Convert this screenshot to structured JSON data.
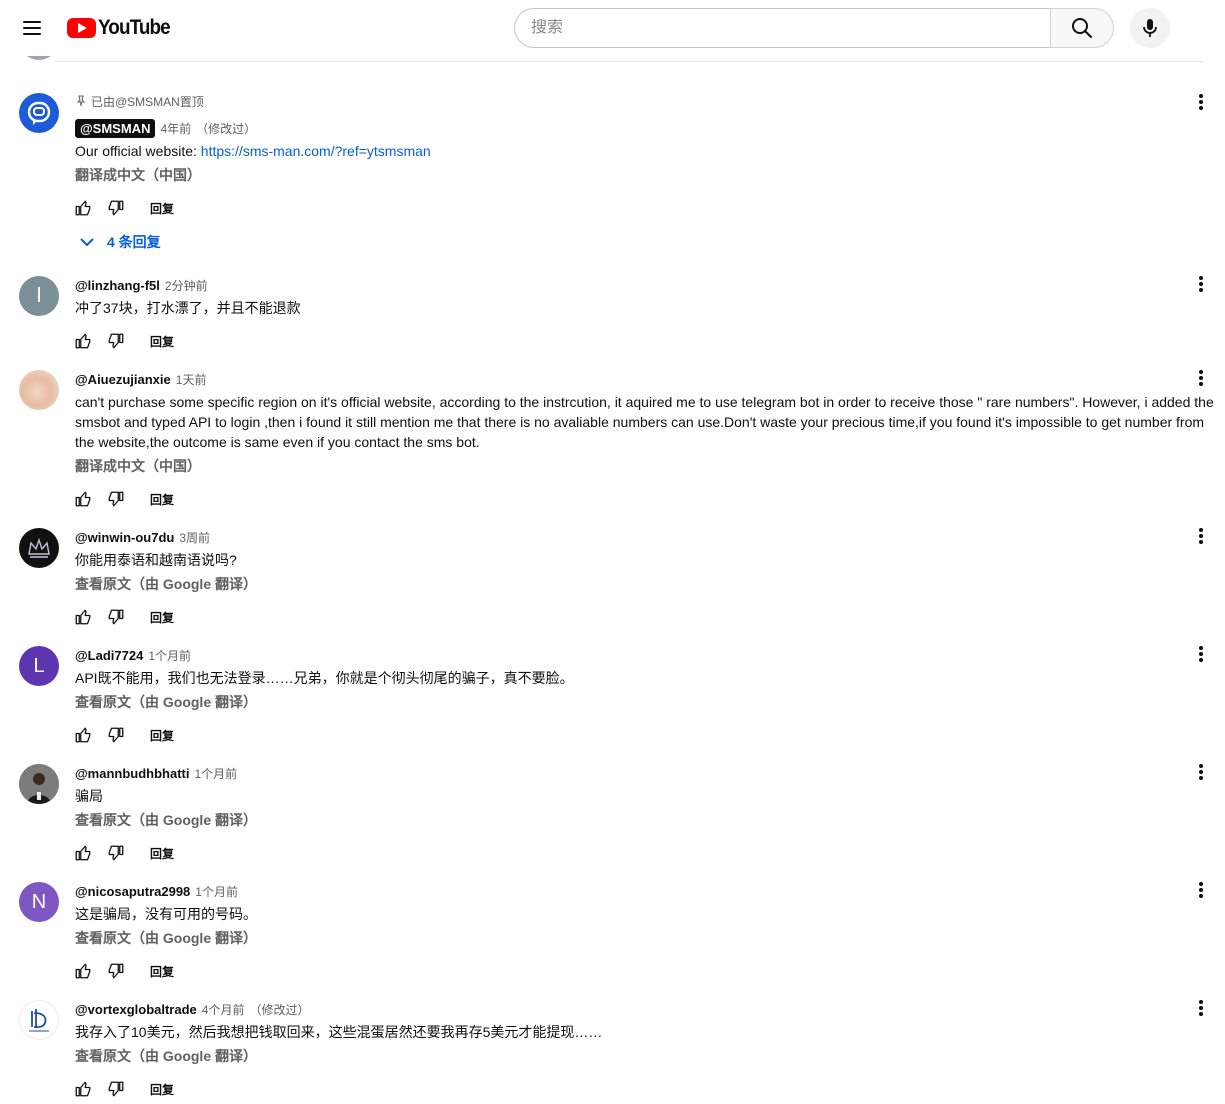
{
  "header": {
    "logo_text": "YouTube",
    "search_placeholder": "搜索"
  },
  "comments": [
    {
      "pinned_label": "已由@SMSMAN置顶",
      "author": "@SMSMAN",
      "time": "4年前",
      "edited": "（修改过）",
      "text_prefix": "Our official website: ",
      "link": "https://sms-man.com/?ref=ytsmsman",
      "translate": "翻译成中文（中国）",
      "reply": "回复",
      "replies_toggle": "4 条回复",
      "avatar_color": "#1e5bd8"
    },
    {
      "author": "@linzhang-f5l",
      "time": "2分钟前",
      "text": "冲了37块，打水漂了，并且不能退款",
      "reply": "回复",
      "avatar_letter": "l",
      "avatar_color": "#7b8f99"
    },
    {
      "author": "@Aiuezujianxie",
      "time": "1天前",
      "text": "can't purchase some specific region on it's official website, according to the instrcution, it aquired me to use telegram bot in order to receive those \" rare numbers\". However,  i added the smsbot and typed API to login ,then i found it still mention me that there is no avaliable numbers can use.Don't waste your precious time,if you found it's impossible to get number from the website,the outcome is same even if you contact the sms bot.",
      "translate": "翻译成中文（中国）",
      "reply": "回复",
      "avatar_color": "#e8c9b6"
    },
    {
      "author": "@winwin-ou7du",
      "time": "3周前",
      "text": "你能用泰语和越南语说吗?",
      "translate": "查看原文（由 Google 翻译）",
      "reply": "回复",
      "avatar_color": "#111111"
    },
    {
      "author": "@Ladi7724",
      "time": "1个月前",
      "text": "API既不能用，我们也无法登录……兄弟，你就是个彻头彻尾的骗子，真不要脸。",
      "translate": "查看原文（由 Google 翻译）",
      "reply": "回复",
      "avatar_letter": "L",
      "avatar_color": "#5e35b1"
    },
    {
      "author": "@mannbudhbhatti",
      "time": "1个月前",
      "text": "骗局",
      "translate": "查看原文（由 Google 翻译）",
      "reply": "回复",
      "avatar_color": "#6d6d6d"
    },
    {
      "author": "@nicosaputra2998",
      "time": "1个月前",
      "text": "这是骗局，没有可用的号码。",
      "translate": "查看原文（由 Google 翻译）",
      "reply": "回复",
      "avatar_letter": "N",
      "avatar_color": "#7e57c2"
    },
    {
      "author": "@vortexglobaltrade",
      "time": "4个月前",
      "edited": "（修改过）",
      "text": "我存入了10美元，然后我想把钱取回来，这些混蛋居然还要我再存5美元才能提现……",
      "translate": "查看原文（由 Google 翻译）",
      "reply": "回复",
      "avatar_color": "#ffffff"
    }
  ]
}
